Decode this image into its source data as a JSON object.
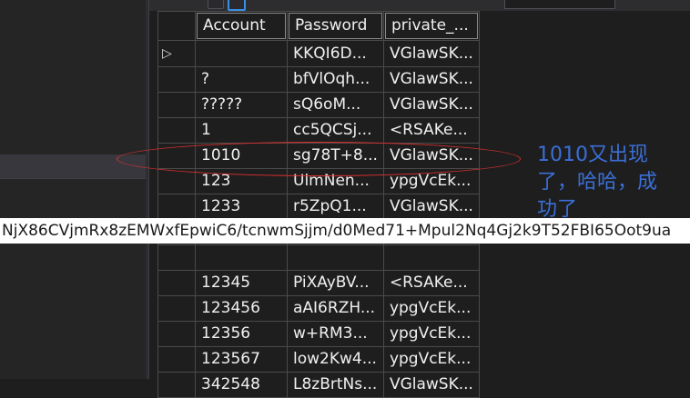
{
  "grid": {
    "columns": [
      "Account",
      "Password",
      "private_..."
    ],
    "rows": [
      {
        "account": "",
        "password": "KKQI6D...",
        "key": "VGlawSK...",
        "current": true
      },
      {
        "account": "?",
        "password": "bfVlOqh...",
        "key": "VGlawSK..."
      },
      {
        "account": "?????",
        "password": "sQ6oM...",
        "key": "VGlawSK..."
      },
      {
        "account": "1",
        "password": "cc5QCSj...",
        "key": "<RSAKe..."
      },
      {
        "account": "1010",
        "password": "sg78T+8...",
        "key": "VGlawSK..."
      },
      {
        "account": "123",
        "password": "UlmNen...",
        "key": "ypgVcEk..."
      },
      {
        "account": "1233",
        "password": "r5ZpQ1...",
        "key": "VGlawSK..."
      },
      {
        "account": "",
        "password": "",
        "key": ""
      },
      {
        "account": "",
        "password": "",
        "key": ""
      },
      {
        "account": "12345",
        "password": "PiXAyBV...",
        "key": "<RSAKe..."
      },
      {
        "account": "123456",
        "password": "aAI6RZH...",
        "key": "ypgVcEk..."
      },
      {
        "account": "12356",
        "password": "w+RM3...",
        "key": "ypgVcEk..."
      },
      {
        "account": "123567",
        "password": "low2Kw4...",
        "key": "ypgVcEk..."
      },
      {
        "account": "342548",
        "password": "L8zBrtNs...",
        "key": "VGlawSK..."
      }
    ]
  },
  "tooltip": {
    "text": "NjX86CVjmRx8zEMWxfEpwiC6/tcnwmSjjm/d0Med71+Mpul2Nq4Gj2k9T52FBI65Oot9ua"
  },
  "annotation": {
    "line1": "1010又出现",
    "line2": "了，哈哈，成",
    "line3": "功了"
  },
  "icons": {
    "current_row": "row-pointer-icon"
  },
  "colors": {
    "annotation": "#3a6fd8",
    "highlight_ellipse": "#e03030",
    "tooltip_bg": "#ffffff"
  }
}
